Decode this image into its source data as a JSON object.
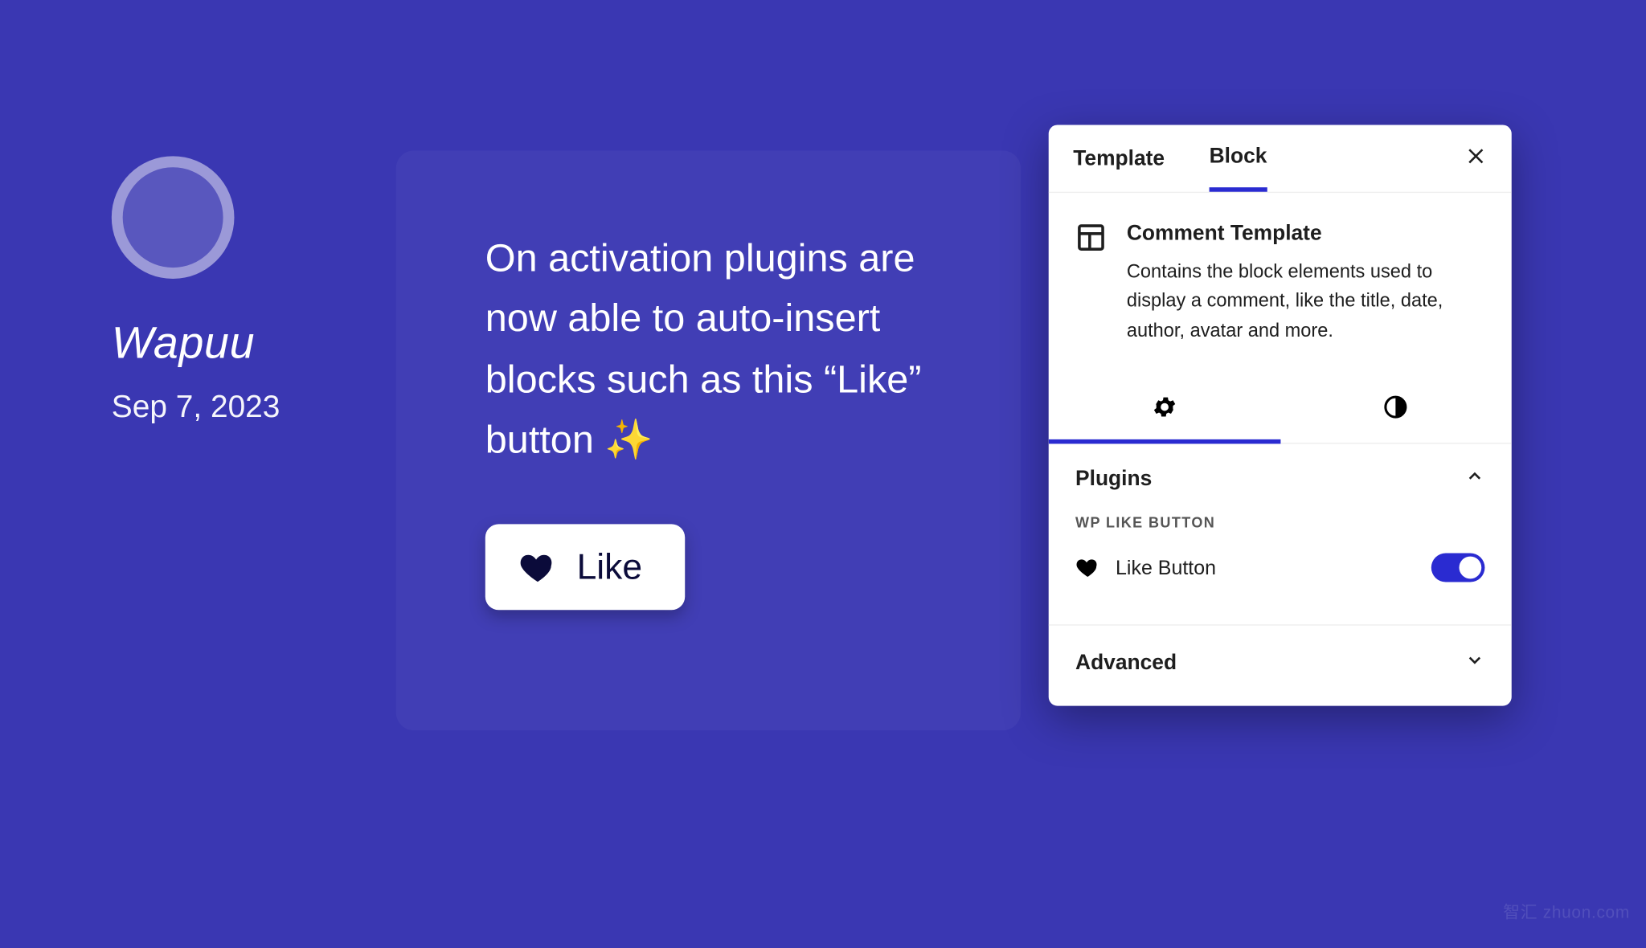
{
  "author": {
    "name": "Wapuu",
    "date": "Sep 7, 2023"
  },
  "content": {
    "text": "On activation plugins are now able to auto-insert blocks such as this “Like” button ✨",
    "like_label": "Like"
  },
  "panel": {
    "tabs": {
      "template": "Template",
      "block": "Block"
    },
    "block": {
      "title": "Comment Template",
      "description": "Contains the block elements used to display a comment, like the title, date, author, avatar and more."
    },
    "sections": {
      "plugins": "Plugins",
      "plugin_group": "WP LIKE BUTTON",
      "like_button_label": "Like Button",
      "advanced": "Advanced"
    }
  },
  "watermark": "智汇 zhuon.com"
}
